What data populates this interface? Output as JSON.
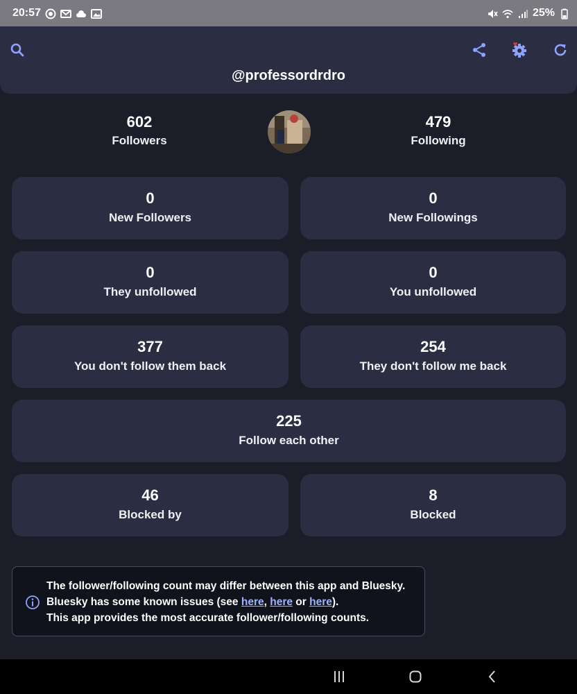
{
  "status_bar": {
    "time": "20:57",
    "battery": "25%",
    "left_icons": [
      "chat-bubble-icon",
      "mail-icon",
      "cloud-icon",
      "image-icon"
    ],
    "right_icons": [
      "mute-icon",
      "wifi-icon",
      "signal-icon",
      "battery-icon"
    ]
  },
  "header": {
    "handle": "@professordrdro",
    "buttons": [
      "search-icon",
      "share-icon",
      "settings-icon",
      "refresh-icon"
    ],
    "accent": "#8ea2ff",
    "badge_color": "#d9363e"
  },
  "profile": {
    "followers_count": "602",
    "followers_label": "Followers",
    "following_count": "479",
    "following_label": "Following"
  },
  "cards": {
    "new_followers": {
      "value": "0",
      "label": "New Followers"
    },
    "new_followings": {
      "value": "0",
      "label": "New Followings"
    },
    "they_unfollowed": {
      "value": "0",
      "label": "They unfollowed"
    },
    "you_unfollowed": {
      "value": "0",
      "label": "You unfollowed"
    },
    "not_following_back": {
      "value": "377",
      "label": "You don't follow them back"
    },
    "not_followed_back": {
      "value": "254",
      "label": "They don't follow me back"
    },
    "mutual": {
      "value": "225",
      "label": "Follow each other"
    },
    "blocked_by": {
      "value": "46",
      "label": "Blocked by"
    },
    "blocked": {
      "value": "8",
      "label": "Blocked"
    }
  },
  "info": {
    "line1": "The follower/following count may differ between this app and Bluesky.",
    "line2_prefix": "Bluesky has some known issues (see ",
    "link1": "here",
    "sep1": ", ",
    "link2": "here",
    "sep2": " or ",
    "link3": "here",
    "line2_suffix": ").",
    "line3": "This app provides the most accurate follower/following counts."
  },
  "nav": {
    "buttons": [
      "recent-apps-icon",
      "home-icon",
      "back-icon"
    ]
  }
}
